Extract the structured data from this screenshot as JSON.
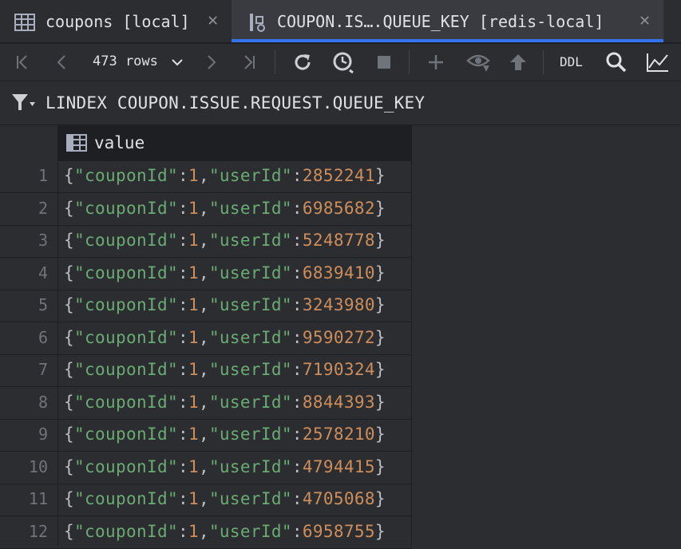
{
  "tabs": [
    {
      "label": "coupons [local]",
      "icon": "table-icon"
    },
    {
      "label": "COUPON.IS….QUEUE_KEY [redis-local]",
      "icon": "redis-key-icon",
      "active": true
    }
  ],
  "toolbar": {
    "rows_label": "473 rows",
    "ddl_label": "DDL"
  },
  "query": {
    "text": "LINDEX COUPON.ISSUE.REQUEST.QUEUE_KEY"
  },
  "grid": {
    "column": "value",
    "rows": [
      {
        "num": "1",
        "couponId": "1",
        "userId": "2852241"
      },
      {
        "num": "2",
        "couponId": "1",
        "userId": "6985682"
      },
      {
        "num": "3",
        "couponId": "1",
        "userId": "5248778"
      },
      {
        "num": "4",
        "couponId": "1",
        "userId": "6839410"
      },
      {
        "num": "5",
        "couponId": "1",
        "userId": "3243980"
      },
      {
        "num": "6",
        "couponId": "1",
        "userId": "9590272"
      },
      {
        "num": "7",
        "couponId": "1",
        "userId": "7190324"
      },
      {
        "num": "8",
        "couponId": "1",
        "userId": "8844393"
      },
      {
        "num": "9",
        "couponId": "1",
        "userId": "2578210"
      },
      {
        "num": "10",
        "couponId": "1",
        "userId": "4794415"
      },
      {
        "num": "11",
        "couponId": "1",
        "userId": "4705068"
      },
      {
        "num": "12",
        "couponId": "1",
        "userId": "6958755"
      }
    ]
  },
  "colors": {
    "background": "#2b2d30",
    "accent": "#3574f0",
    "json_key": "#6aab73",
    "json_number": "#ce8e5c"
  }
}
